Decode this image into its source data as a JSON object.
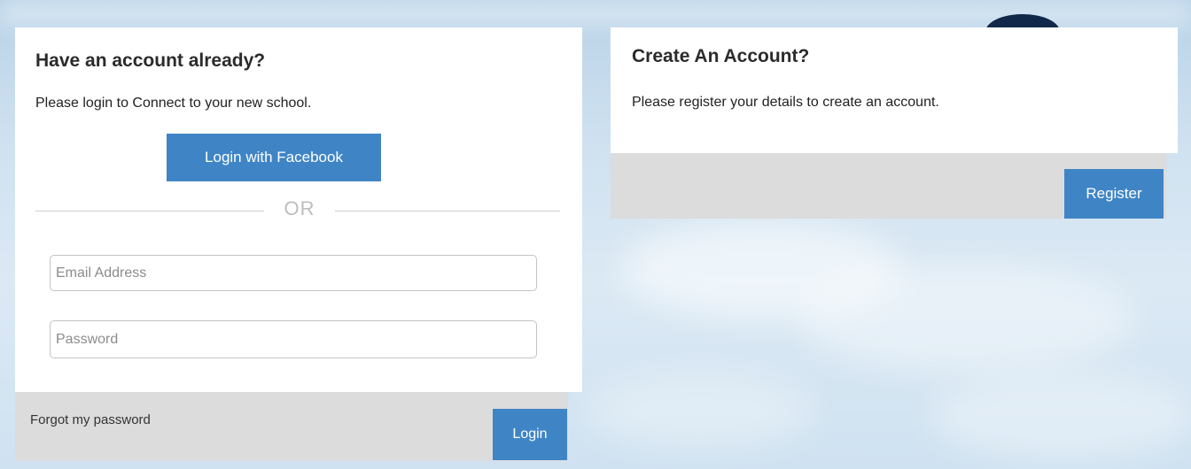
{
  "login": {
    "heading": "Have an account already?",
    "subtext": "Please login to Connect to your new school.",
    "facebook_button": "Login with Facebook",
    "separator": "OR",
    "email_placeholder": "Email Address",
    "password_placeholder": "Password",
    "forgot_link": "Forgot my password",
    "login_button": "Login"
  },
  "register": {
    "heading": "Create An Account?",
    "subtext": "Please register your details to create an account.",
    "register_button": "Register"
  },
  "colors": {
    "accent": "#3f85c6",
    "footer_bg": "#dcdcdc",
    "panel_bg": "#ffffff"
  }
}
